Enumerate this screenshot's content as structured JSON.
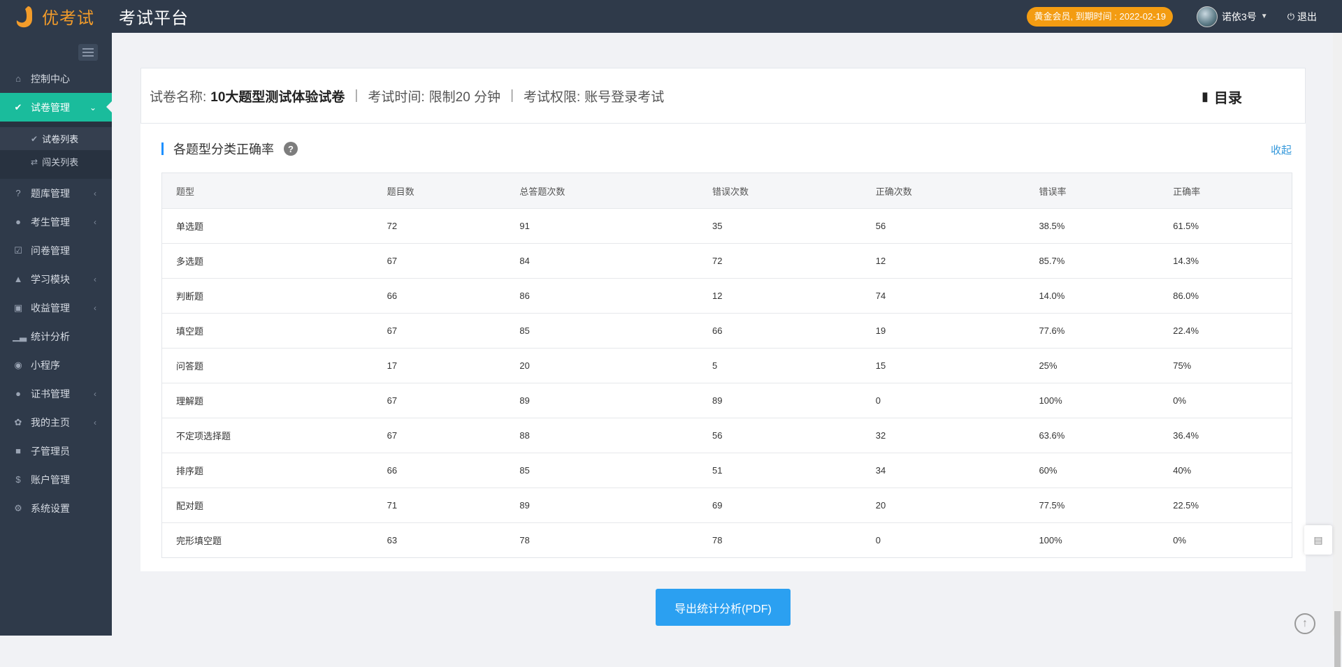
{
  "header": {
    "brand": "优考试",
    "platform_title": "考试平台",
    "member_badge": "黄金会员, 到期时间 : 2022-02-19",
    "user_name": "诺依3号",
    "logout_label": "退出"
  },
  "sidebar": {
    "items": [
      {
        "label": "控制中心",
        "icon": "home-icon",
        "arrow": false
      },
      {
        "label": "试卷管理",
        "icon": "check-circle-icon",
        "arrow": true,
        "active": true,
        "children": [
          {
            "label": "试卷列表",
            "icon": "check-circle-icon",
            "active": true
          },
          {
            "label": "闯关列表",
            "icon": "shuffle-icon"
          }
        ]
      },
      {
        "label": "题库管理",
        "icon": "question-circle-icon",
        "arrow": true
      },
      {
        "label": "考生管理",
        "icon": "user-icon",
        "arrow": true
      },
      {
        "label": "问卷管理",
        "icon": "checkbox-icon",
        "arrow": false
      },
      {
        "label": "学习模块",
        "icon": "graduation-cap-icon",
        "arrow": true
      },
      {
        "label": "收益管理",
        "icon": "money-icon",
        "arrow": true
      },
      {
        "label": "统计分析",
        "icon": "bar-chart-icon",
        "arrow": false
      },
      {
        "label": "小程序",
        "icon": "wechat-icon",
        "arrow": false
      },
      {
        "label": "证书管理",
        "icon": "circle-icon",
        "arrow": true
      },
      {
        "label": "我的主页",
        "icon": "leaf-icon",
        "arrow": true
      },
      {
        "label": "子管理员",
        "icon": "user-lock-icon",
        "arrow": false
      },
      {
        "label": "账户管理",
        "icon": "dollar-icon",
        "arrow": false
      },
      {
        "label": "系统设置",
        "icon": "gear-icon",
        "arrow": false
      }
    ]
  },
  "exam": {
    "name_label": "试卷名称:",
    "name_value": "10大题型测试体验试卷",
    "time_label": "考试时间:",
    "time_value": "限制20 分钟",
    "auth_label": "考试权限:",
    "auth_value": "账号登录考试",
    "toc_label": "目录"
  },
  "stats": {
    "title": "各题型分类正确率",
    "collapse_label": "收起",
    "columns": [
      "题型",
      "题目数",
      "总答题次数",
      "错误次数",
      "正确次数",
      "错误率",
      "正确率"
    ],
    "rows": [
      [
        "单选题",
        "72",
        "91",
        "35",
        "56",
        "38.5%",
        "61.5%"
      ],
      [
        "多选题",
        "67",
        "84",
        "72",
        "12",
        "85.7%",
        "14.3%"
      ],
      [
        "判断题",
        "66",
        "86",
        "12",
        "74",
        "14.0%",
        "86.0%"
      ],
      [
        "填空题",
        "67",
        "85",
        "66",
        "19",
        "77.6%",
        "22.4%"
      ],
      [
        "问答题",
        "17",
        "20",
        "5",
        "15",
        "25%",
        "75%"
      ],
      [
        "理解题",
        "67",
        "89",
        "89",
        "0",
        "100%",
        "0%"
      ],
      [
        "不定项选择题",
        "67",
        "88",
        "56",
        "32",
        "63.6%",
        "36.4%"
      ],
      [
        "排序题",
        "66",
        "85",
        "51",
        "34",
        "60%",
        "40%"
      ],
      [
        "配对题",
        "71",
        "89",
        "69",
        "20",
        "77.5%",
        "22.5%"
      ],
      [
        "完形填空题",
        "63",
        "78",
        "78",
        "0",
        "100%",
        "0%"
      ]
    ]
  },
  "export_button": "导出统计分析(PDF)",
  "colors": {
    "sidebar_bg": "#2f3a4a",
    "active": "#1abc9c",
    "badge": "#f39c12",
    "primary": "#2ba0f1"
  }
}
